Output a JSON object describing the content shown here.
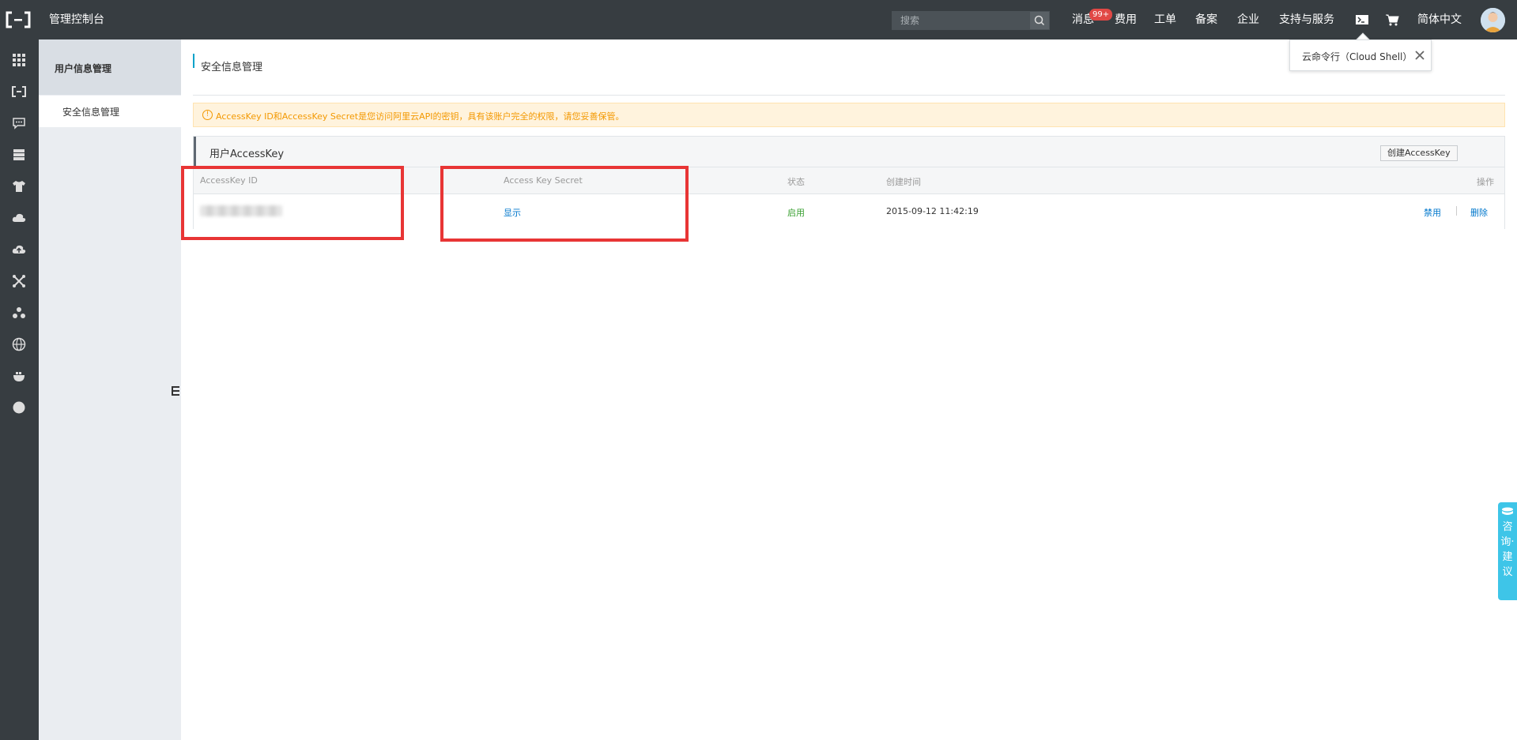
{
  "topbar": {
    "title": "管理控制台",
    "search_placeholder": "搜索",
    "nav": {
      "messages": "消息",
      "messages_badge": "99+",
      "billing": "费用",
      "tickets": "工单",
      "icp": "备案",
      "enterprise": "企业",
      "support": "支持与服务",
      "language": "简体中文"
    }
  },
  "sidebar": {
    "header": "用户信息管理",
    "items": [
      {
        "label": "安全信息管理"
      }
    ]
  },
  "main": {
    "page_title": "安全信息管理",
    "warning": "AccessKey ID和AccessKey Secret是您访问阿里云API的密钥，具有该账户完全的权限，请您妥善保管。",
    "panel_title": "用户AccessKey",
    "create_button": "创建AccessKey",
    "table": {
      "headers": {
        "id": "AccessKey ID",
        "secret": "Access Key Secret",
        "status": "状态",
        "created": "创建时间",
        "actions": "操作"
      },
      "rows": [
        {
          "secret": "显示",
          "status": "启用",
          "created": "2015-09-12 11:42:19",
          "disable": "禁用",
          "delete": "删除"
        }
      ]
    }
  },
  "cloud_shell_tip": {
    "text": "云命令行（Cloud Shell）"
  },
  "consult": {
    "text": "咨询·建议"
  },
  "colors": {
    "topbar": "#373d41",
    "accent": "#00a2ca",
    "link": "#0077cc",
    "warning": "#f39800",
    "enabled": "#3aa032",
    "highlight": "#e83535"
  }
}
